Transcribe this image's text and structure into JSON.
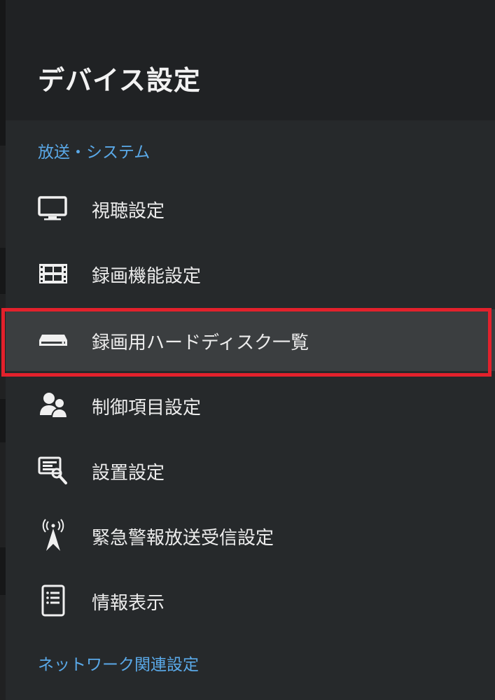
{
  "header": {
    "title": "デバイス設定"
  },
  "sections": [
    {
      "heading": "放送・システム",
      "items": [
        {
          "label": "視聴設定",
          "icon": "tv-icon"
        },
        {
          "label": "録画機能設定",
          "icon": "film-icon"
        },
        {
          "label": "録画用ハードディスク一覧",
          "icon": "hard-disk-icon",
          "selected": true
        },
        {
          "label": "制御項目設定",
          "icon": "users-icon"
        },
        {
          "label": "設置設定",
          "icon": "setup-tool-icon"
        },
        {
          "label": "緊急警報放送受信設定",
          "icon": "antenna-icon"
        },
        {
          "label": "情報表示",
          "icon": "document-icon"
        }
      ]
    },
    {
      "heading": "ネットワーク関連設定",
      "items": []
    }
  ],
  "colors": {
    "section_heading": "#5aa9e8",
    "selection_outline": "#e3212c",
    "panel_background": "#26292b",
    "header_background": "#202224"
  }
}
